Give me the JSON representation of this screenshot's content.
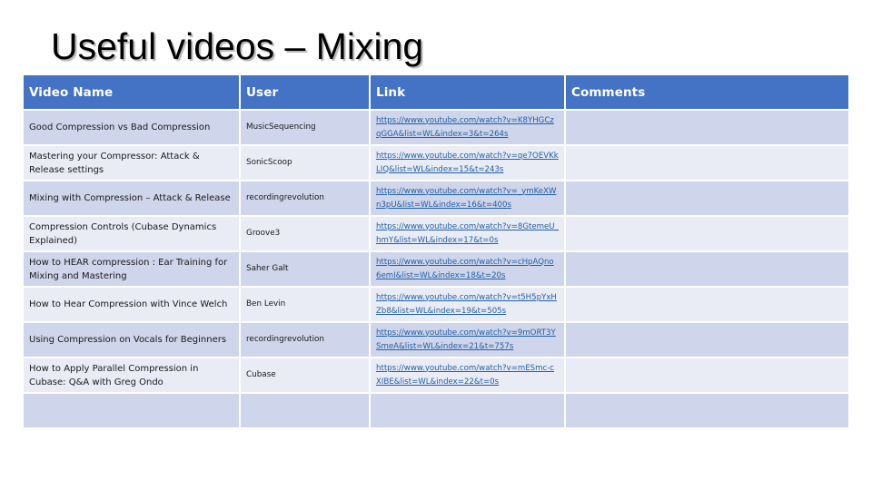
{
  "slide": {
    "title": "Useful videos – Mixing"
  },
  "colors": {
    "header_bg": "#4472c4",
    "row_odd_bg": "#cfd5ea",
    "row_even_bg": "#e9ebf5",
    "link": "#1f5fa8"
  },
  "table": {
    "headers": {
      "video_name": "Video Name",
      "user": "User",
      "link": "Link",
      "comments": "Comments"
    },
    "rows": [
      {
        "video_name": "Good Compression vs Bad Compression",
        "user": "MusicSequencing",
        "link": "https://www.youtube.com/watch?v=K8YHGCzqGGA&list=WL&index=3&t=264s",
        "comments": ""
      },
      {
        "video_name": "Mastering your Compressor: Attack & Release settings",
        "user": "SonicScoop",
        "link": "https://www.youtube.com/watch?v=qe7OEVKkLIQ&list=WL&index=15&t=243s",
        "comments": ""
      },
      {
        "video_name": "Mixing with Compression – Attack & Release",
        "user": "recordingrevolution",
        "link": "https://www.youtube.com/watch?v=_ymKeXWn3pU&list=WL&index=16&t=400s",
        "comments": ""
      },
      {
        "video_name": "Compression Controls (Cubase Dynamics Explained)",
        "user": "Groove3",
        "link": "https://www.youtube.com/watch?v=8GtemeU_hmY&list=WL&index=17&t=0s",
        "comments": ""
      },
      {
        "video_name": "How to HEAR compression : Ear Training for Mixing and Mastering",
        "user": "Saher Galt",
        "link": "https://www.youtube.com/watch?v=cHpAQno6emI&list=WL&index=18&t=20s",
        "comments": ""
      },
      {
        "video_name": "How to Hear Compression with Vince Welch",
        "user": "Ben Levin",
        "link": "https://www.youtube.com/watch?v=t5H5pYxHZb8&list=WL&index=19&t=505s",
        "comments": ""
      },
      {
        "video_name": "Using Compression on Vocals for Beginners",
        "user": "recordingrevolution",
        "link": "https://www.youtube.com/watch?v=9mORT3YSmeA&list=WL&index=21&t=757s",
        "comments": ""
      },
      {
        "video_name": "How to Apply Parallel Compression in Cubase: Q&A with Greg Ondo",
        "user": "Cubase",
        "link": "https://www.youtube.com/watch?v=mESmc-cXIBE&list=WL&index=22&t=0s",
        "comments": ""
      },
      {
        "video_name": "",
        "user": "",
        "link": "",
        "comments": ""
      }
    ]
  }
}
